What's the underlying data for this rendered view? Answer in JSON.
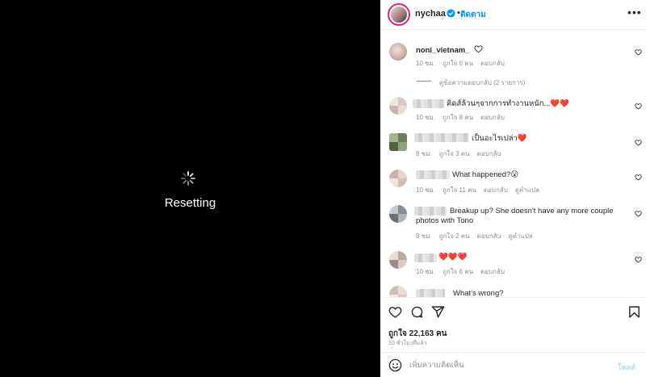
{
  "media": {
    "status_text": "Resetting"
  },
  "header": {
    "username": "nychaa",
    "dot": "•",
    "follow_label": "ติดตาม"
  },
  "comments": [
    {
      "username": "noni_vietnam_",
      "text": "",
      "time": "10 ชม.",
      "likes": "ถูกใจ 6 คน",
      "reply": "ตอบกลับ",
      "see_translation": ""
    },
    {
      "username": "",
      "text": "คิดส์ล้วนๆจากการทำงานหนัก...❤️❤️",
      "time": "10 ชม.",
      "likes": "ถูกใจ 8 คน",
      "reply": "ตอบกลับ",
      "see_translation": ""
    },
    {
      "username": "",
      "text": "เป็นอะไรเปล่า❤️",
      "time": "8 ชม.",
      "likes": "ถูกใจ 3 คน",
      "reply": "ตอบกลับ",
      "see_translation": ""
    },
    {
      "username": "",
      "text": "What happened?😮",
      "time": "10 ชม.",
      "likes": "ถูกใจ 11 คน",
      "reply": "ตอบกลับ",
      "see_translation": "ดูคำแปล"
    },
    {
      "username": "",
      "text": "Breakup up? She doesn't have any more couple photos with Tono",
      "time": "9 ชม.",
      "likes": "ถูกใจ 2 คน",
      "reply": "ตอบกลับ",
      "see_translation": "ดูคำแปล"
    },
    {
      "username": "",
      "text": "❤️❤️❤️",
      "time": "10 ชม.",
      "likes": "ถูกใจ 6 คน",
      "reply": "ตอบกลับ",
      "see_translation": ""
    },
    {
      "username": "",
      "text": "What's wrong?",
      "time": "",
      "likes": "",
      "reply": "",
      "see_translation": ""
    }
  ],
  "view_replies": "ดูข้อความตอบกลับ (2 รายการ)",
  "actions": {
    "likes_count": "ถูกใจ 22,163 คน",
    "time_ago": "10 ชั่วโมงที่แล้ว"
  },
  "add_comment": {
    "placeholder": "เพิ่มความคิดเห็น",
    "post_label": "โพสต์"
  },
  "icons": [
    "spinner-icon",
    "verified-icon",
    "more-icon",
    "heart-icon",
    "comment-icon",
    "share-icon",
    "bookmark-icon",
    "emoji-icon"
  ],
  "colors": {
    "accent": "#0095f6",
    "like_red": "#ed4956",
    "muted": "#8e8e8e"
  }
}
